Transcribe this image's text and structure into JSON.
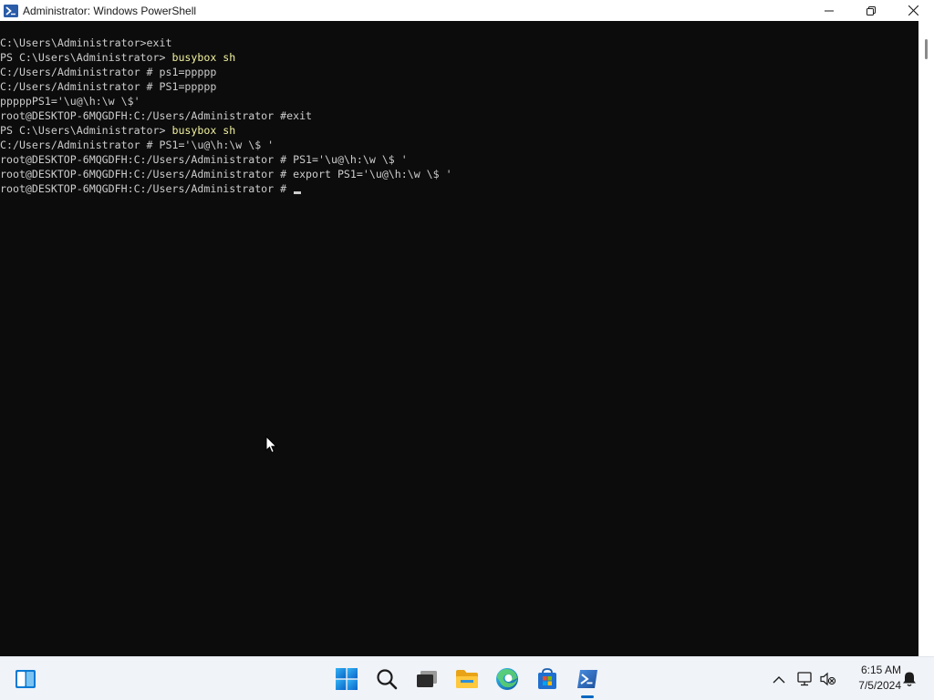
{
  "window": {
    "title": "Administrator: Windows PowerShell"
  },
  "console": {
    "lines": [
      {
        "prompt": "C:\\Users\\Administrator>",
        "command": "exit"
      },
      {
        "prompt": "PS C:\\Users\\Administrator> ",
        "command": "busybox sh"
      },
      {
        "prompt": "C:/Users/Administrator # ",
        "command": "ps1=ppppp"
      },
      {
        "prompt": "C:/Users/Administrator # ",
        "command": "PS1=ppppp"
      },
      {
        "prompt": "pppppPS1='\\u@\\h:\\w \\$'",
        "command": ""
      },
      {
        "prompt": "root@DESKTOP-6MQGDFH:C:/Users/Administrator #",
        "command": "exit"
      },
      {
        "prompt": "PS C:\\Users\\Administrator> ",
        "command": "busybox sh"
      },
      {
        "prompt": "C:/Users/Administrator # ",
        "command": "PS1='\\u@\\h:\\w \\$ '"
      },
      {
        "prompt": "root@DESKTOP-6MQGDFH:C:/Users/Administrator # ",
        "command": "PS1='\\u@\\h:\\w \\$ '"
      },
      {
        "prompt": "root@DESKTOP-6MQGDFH:C:/Users/Administrator # ",
        "command": "export PS1='\\u@\\h:\\w \\$ '"
      },
      {
        "prompt": "root@DESKTOP-6MQGDFH:C:/Users/Administrator # ",
        "command": ""
      }
    ]
  },
  "taskbar": {
    "pinned": [
      "widgets-icon",
      "start-icon",
      "search-icon",
      "task-view-icon",
      "file-explorer-icon",
      "edge-icon",
      "store-icon",
      "powershell-icon"
    ],
    "active": "powershell-icon"
  },
  "tray": {
    "icons": [
      "show-hidden-icons-chevron",
      "network-icon",
      "volume-muted-icon",
      "notification-icon"
    ],
    "time": "6:15 AM",
    "date": "7/5/2024"
  },
  "colors": {
    "console_bg": "#0c0c0c",
    "console_text": "#cccccc",
    "command_text": "#f2f2a0",
    "accent": "#0067c0"
  }
}
